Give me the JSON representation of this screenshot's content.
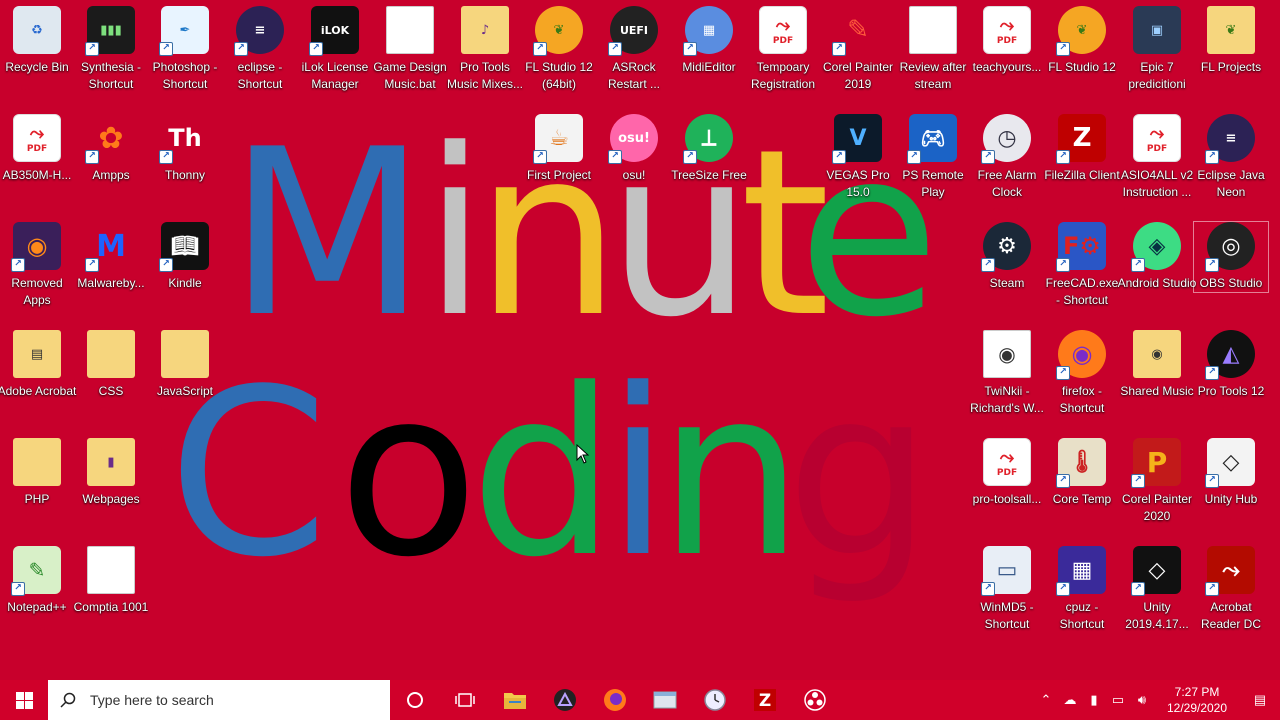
{
  "wallpaper": {
    "line1": [
      "M",
      "i",
      "n",
      "u",
      "t",
      "e"
    ],
    "line2": [
      "C",
      "o",
      "d",
      "i",
      "n",
      "g"
    ],
    "colors": {
      "blue": "#2f6db3",
      "gray": "#c2c2c2",
      "yellow": "#f0bf2a",
      "green": "#11a24a",
      "black": "#000000",
      "red": "#b80030"
    }
  },
  "desktop": {
    "icons": [
      {
        "label": "Recycle Bin",
        "icon": "recycle-bin-icon"
      },
      {
        "label": "Synthesia - Shortcut",
        "icon": "synthesia-icon"
      },
      {
        "label": "Photoshop - Shortcut",
        "icon": "photoshop-icon"
      },
      {
        "label": "eclipse - Shortcut",
        "icon": "eclipse-icon"
      },
      {
        "label": "iLok License Manager",
        "icon": "ilok-icon"
      },
      {
        "label": "Game Design Music.bat",
        "icon": "batch-file-icon"
      },
      {
        "label": "Pro Tools Music Mixes...",
        "icon": "folder-icon"
      },
      {
        "label": "FL Studio 12 (64bit)",
        "icon": "fl-studio-icon"
      },
      {
        "label": "ASRock Restart ...",
        "icon": "uefi-icon"
      },
      {
        "label": "MidiEditor",
        "icon": "midieditor-icon"
      },
      {
        "label": "Tempoary Registration",
        "icon": "pdf-icon"
      },
      {
        "label": "Corel Painter 2019",
        "icon": "corel-painter-icon"
      },
      {
        "label": "Review after stream",
        "icon": "text-file-icon"
      },
      {
        "label": "teachyours...",
        "icon": "pdf-icon"
      },
      {
        "label": "FL Studio 12",
        "icon": "fl-studio-icon"
      },
      {
        "label": "Epic 7 predicitioni",
        "icon": "image-file-icon"
      },
      {
        "label": "FL Projects",
        "icon": "folder-icon"
      },
      {
        "label": "AB350M-H...",
        "icon": "pdf-icon"
      },
      {
        "label": "Ampps",
        "icon": "ampps-icon"
      },
      {
        "label": "Thonny",
        "icon": "thonny-icon"
      },
      {
        "label": "First Project",
        "icon": "java-icon"
      },
      {
        "label": "osu!",
        "icon": "osu-icon"
      },
      {
        "label": "TreeSize Free",
        "icon": "treesize-icon"
      },
      {
        "label": "VEGAS Pro 15.0",
        "icon": "vegas-icon"
      },
      {
        "label": "PS Remote Play",
        "icon": "ps-remote-icon"
      },
      {
        "label": "Free Alarm Clock",
        "icon": "alarm-clock-icon"
      },
      {
        "label": "FileZilla Client",
        "icon": "filezilla-icon"
      },
      {
        "label": "ASIO4ALL v2 Instruction ...",
        "icon": "pdf-icon"
      },
      {
        "label": "Eclipse Java Neon",
        "icon": "eclipse-icon"
      },
      {
        "label": "Removed Apps",
        "icon": "firefox-icon"
      },
      {
        "label": "Malwareby...",
        "icon": "malwarebytes-icon"
      },
      {
        "label": "Kindle",
        "icon": "kindle-icon"
      },
      {
        "label": "Steam",
        "icon": "steam-icon"
      },
      {
        "label": "FreeCAD.exe - Shortcut",
        "icon": "freecad-icon"
      },
      {
        "label": "Android Studio",
        "icon": "android-studio-icon"
      },
      {
        "label": "OBS Studio",
        "icon": "obs-icon"
      },
      {
        "label": "Adobe Acrobat",
        "icon": "folder-icon"
      },
      {
        "label": "CSS",
        "icon": "folder-icon"
      },
      {
        "label": "JavaScript",
        "icon": "folder-icon"
      },
      {
        "label": "TwiNkii - Richard's W...",
        "icon": "music-file-icon"
      },
      {
        "label": "firefox - Shortcut",
        "icon": "firefox-icon"
      },
      {
        "label": "Shared Music",
        "icon": "folder-icon"
      },
      {
        "label": "Pro Tools 12",
        "icon": "pro-tools-icon"
      },
      {
        "label": "PHP",
        "icon": "folder-icon"
      },
      {
        "label": "Webpages",
        "icon": "folder-icon"
      },
      {
        "label": "pro-toolsall...",
        "icon": "pdf-icon"
      },
      {
        "label": "Core Temp",
        "icon": "core-temp-icon"
      },
      {
        "label": "Corel Painter 2020",
        "icon": "corel-painter-icon"
      },
      {
        "label": "Unity Hub",
        "icon": "unity-hub-icon"
      },
      {
        "label": "Notepad++",
        "icon": "notepad-plus-icon"
      },
      {
        "label": "Comptia 1001",
        "icon": "text-file-icon"
      },
      {
        "label": "WinMD5 - Shortcut",
        "icon": "winmd5-icon"
      },
      {
        "label": "cpuz - Shortcut",
        "icon": "cpuz-icon"
      },
      {
        "label": "Unity 2019.4.17...",
        "icon": "unity-icon"
      },
      {
        "label": "Acrobat Reader DC",
        "icon": "acrobat-reader-icon"
      }
    ]
  },
  "taskbar": {
    "search_placeholder": "Type here to search",
    "time": "7:27 PM",
    "date": "12/29/2020",
    "pinned": [
      "cortana-icon",
      "task-view-icon",
      "file-explorer-icon",
      "pro-tools-icon",
      "firefox-icon",
      "app-window-icon",
      "clock-app-icon",
      "filezilla-icon",
      "obs-icon"
    ]
  }
}
